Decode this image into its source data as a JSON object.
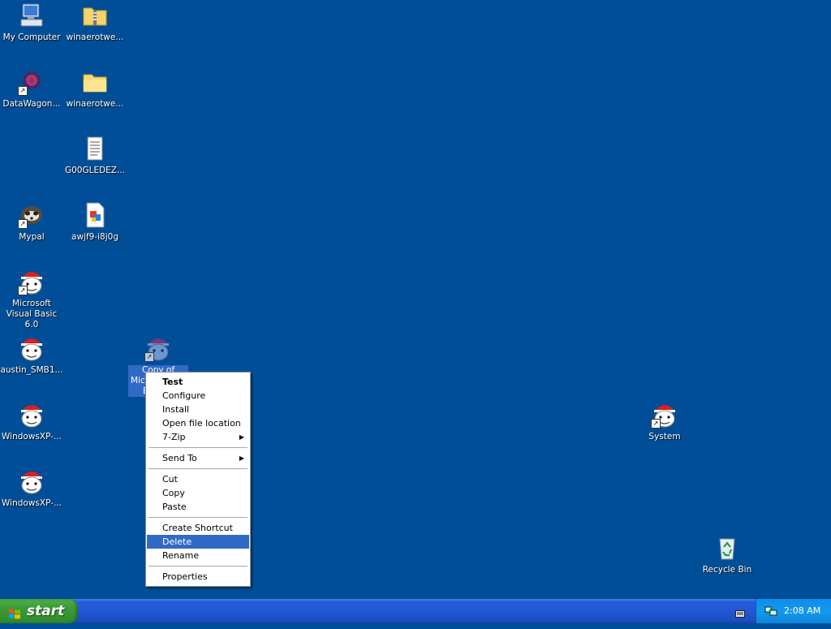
{
  "desktop": {
    "icons": [
      {
        "label": "My Computer",
        "icon": "computer-icon"
      },
      {
        "label": "winaerotwe...",
        "icon": "zip-folder-icon"
      },
      {
        "label": "DataWagon...",
        "icon": "datawagon-icon"
      },
      {
        "label": "winaerotwe...",
        "icon": "folder-icon"
      },
      {
        "label": "G00GLEDEZ...",
        "icon": "text-file-icon"
      },
      {
        "label": "Mypal",
        "icon": "mypal-icon"
      },
      {
        "label": "awjf9-i8j0g",
        "icon": "image-file-icon"
      },
      {
        "label": "Microsoft Visual Basic 6.0",
        "icon": "santa-icon"
      },
      {
        "label": "austin_SMB1...",
        "icon": "santa-icon"
      },
      {
        "label": "Copy of Microsoft Visual Basic 6.0",
        "icon": "santa-icon"
      },
      {
        "label": "WindowsXP-...",
        "icon": "santa-icon"
      },
      {
        "label": "WindowsXP-...",
        "icon": "santa-icon"
      },
      {
        "label": "System",
        "icon": "santa-icon"
      },
      {
        "label": "Recycle Bin",
        "icon": "recycle-bin-icon"
      }
    ],
    "selected_label_visible": [
      "Copy of",
      "Micro",
      "B"
    ]
  },
  "context_menu": {
    "items": [
      {
        "label": "Test",
        "bold": true
      },
      {
        "label": "Configure"
      },
      {
        "label": "Install"
      },
      {
        "label": "Open file location"
      },
      {
        "label": "7-Zip",
        "submenu": true
      },
      {
        "label": "Send To",
        "submenu": true
      },
      {
        "label": "Cut"
      },
      {
        "label": "Copy"
      },
      {
        "label": "Paste"
      },
      {
        "label": "Create Shortcut"
      },
      {
        "label": "Delete",
        "highlighted": true
      },
      {
        "label": "Rename"
      },
      {
        "label": "Properties"
      }
    ],
    "submenu_arrow": "▶"
  },
  "taskbar": {
    "start_label": "start",
    "clock": "2:08 AM",
    "icons": [
      "keyboard-icon",
      "network-icon"
    ]
  },
  "colors": {
    "desktop": "#004e98",
    "highlight": "#316ac5",
    "taskbar": "#245edb",
    "start_button": "#3a9a36",
    "tray": "#0f8cec"
  }
}
